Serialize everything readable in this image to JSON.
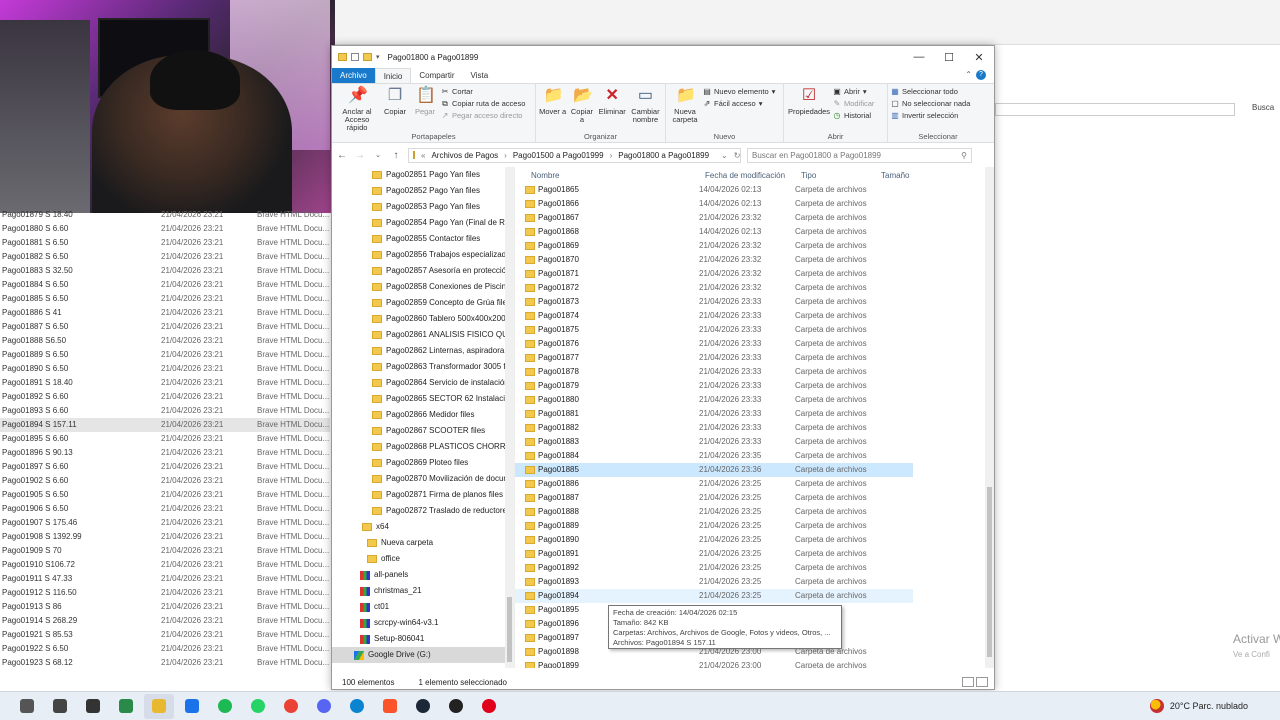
{
  "explorer": {
    "title": "Pago01800 a Pago01899",
    "tabs": {
      "archivo": "Archivo",
      "inicio": "Inicio",
      "compartir": "Compartir",
      "vista": "Vista"
    },
    "ribbon": {
      "portapapeles": {
        "label": "Portapapeles",
        "anclar": "Anclar al Acceso rápido",
        "copiar": "Copiar",
        "pegar": "Pegar",
        "cortar": "Cortar",
        "copiar_ruta": "Copiar ruta de acceso",
        "pegar_acceso": "Pegar acceso directo"
      },
      "organizar": {
        "label": "Organizar",
        "mover": "Mover a",
        "copiar_a": "Copiar a",
        "eliminar": "Eliminar",
        "cambiar": "Cambiar nombre"
      },
      "nuevo": {
        "label": "Nuevo",
        "carpeta": "Nueva carpeta",
        "nuevo_elemento": "Nuevo elemento",
        "facil": "Fácil acceso"
      },
      "abrir": {
        "label": "Abrir",
        "propiedades": "Propiedades",
        "abrir": "Abrir",
        "modificar": "Modificar",
        "historial": "Historial"
      },
      "seleccionar": {
        "label": "Seleccionar",
        "todo": "Seleccionar todo",
        "nada": "No seleccionar nada",
        "invertir": "Invertir selección"
      }
    },
    "address": {
      "crumbs": [
        "Archivos de Pagos",
        "Pago01500 a Pago01999",
        "Pago01800 a Pago01899"
      ],
      "search_placeholder": "Buscar en Pago01800 a Pago01899"
    },
    "tree": [
      {
        "label": "Pago02851 Pago Yan files",
        "icon": "folder"
      },
      {
        "label": "Pago02852 Pago Yan files",
        "icon": "folder"
      },
      {
        "label": "Pago02853 Pago Yan files",
        "icon": "folder"
      },
      {
        "label": "Pago02854 Pago Yan (Final de ROI",
        "icon": "folder"
      },
      {
        "label": "Pago02855 Contactor files",
        "icon": "folder"
      },
      {
        "label": "Pago02856 Trabajos especializados",
        "icon": "folder"
      },
      {
        "label": "Pago02857 Asesoría en protección",
        "icon": "folder"
      },
      {
        "label": "Pago02858 Conexiones de Piscina",
        "icon": "folder"
      },
      {
        "label": "Pago02859 Concepto de Grúa files",
        "icon": "folder"
      },
      {
        "label": "Pago02860 Tablero 500x400x200 , I",
        "icon": "folder"
      },
      {
        "label": "Pago02861 ANALISIS FISICO QUIM",
        "icon": "folder"
      },
      {
        "label": "Pago02862 Linternas, aspiradora, h",
        "icon": "folder"
      },
      {
        "label": "Pago02863 Transformador 3005 fil",
        "icon": "folder"
      },
      {
        "label": "Pago02864 Servicio de instalación",
        "icon": "folder"
      },
      {
        "label": "Pago02865 SECTOR 62 Instalación",
        "icon": "folder"
      },
      {
        "label": "Pago02866 Medidor files",
        "icon": "folder"
      },
      {
        "label": "Pago02867 SCOOTER files",
        "icon": "folder"
      },
      {
        "label": "Pago02868 PLASTICOS CHORRILLO",
        "icon": "folder"
      },
      {
        "label": "Pago02869 Ploteo files",
        "icon": "folder"
      },
      {
        "label": "Pago02870 Movilización de docum",
        "icon": "folder"
      },
      {
        "label": "Pago02871 Firma de planos files",
        "icon": "folder"
      },
      {
        "label": "Pago02872 Traslado de reductores",
        "icon": "folder"
      },
      {
        "label": "x64",
        "icon": "folder"
      },
      {
        "label": "Nueva carpeta",
        "icon": "folder"
      },
      {
        "label": "office",
        "icon": "folder"
      },
      {
        "label": "all-panels",
        "icon": "archive"
      },
      {
        "label": "christmas_21",
        "icon": "archive"
      },
      {
        "label": "ct01",
        "icon": "archive"
      },
      {
        "label": "scrcpy-win64-v3.1",
        "icon": "archive"
      },
      {
        "label": "Setup-806041",
        "icon": "archive"
      },
      {
        "label": "Google Drive (G:)",
        "icon": "drive"
      }
    ],
    "columns": {
      "name": "Nombre",
      "date": "Fecha de modificación",
      "type": "Tipo",
      "size": "Tamaño"
    },
    "files": [
      {
        "name": "Pago01865",
        "date": "14/04/2026 02:13",
        "type": "Carpeta de archivos"
      },
      {
        "name": "Pago01866",
        "date": "14/04/2026 02:13",
        "type": "Carpeta de archivos"
      },
      {
        "name": "Pago01867",
        "date": "21/04/2026 23:32",
        "type": "Carpeta de archivos"
      },
      {
        "name": "Pago01868",
        "date": "14/04/2026 02:13",
        "type": "Carpeta de archivos"
      },
      {
        "name": "Pago01869",
        "date": "21/04/2026 23:32",
        "type": "Carpeta de archivos"
      },
      {
        "name": "Pago01870",
        "date": "21/04/2026 23:32",
        "type": "Carpeta de archivos"
      },
      {
        "name": "Pago01871",
        "date": "21/04/2026 23:32",
        "type": "Carpeta de archivos"
      },
      {
        "name": "Pago01872",
        "date": "21/04/2026 23:32",
        "type": "Carpeta de archivos"
      },
      {
        "name": "Pago01873",
        "date": "21/04/2026 23:33",
        "type": "Carpeta de archivos"
      },
      {
        "name": "Pago01874",
        "date": "21/04/2026 23:33",
        "type": "Carpeta de archivos"
      },
      {
        "name": "Pago01875",
        "date": "21/04/2026 23:33",
        "type": "Carpeta de archivos"
      },
      {
        "name": "Pago01876",
        "date": "21/04/2026 23:33",
        "type": "Carpeta de archivos"
      },
      {
        "name": "Pago01877",
        "date": "21/04/2026 23:33",
        "type": "Carpeta de archivos"
      },
      {
        "name": "Pago01878",
        "date": "21/04/2026 23:33",
        "type": "Carpeta de archivos"
      },
      {
        "name": "Pago01879",
        "date": "21/04/2026 23:33",
        "type": "Carpeta de archivos"
      },
      {
        "name": "Pago01880",
        "date": "21/04/2026 23:33",
        "type": "Carpeta de archivos"
      },
      {
        "name": "Pago01881",
        "date": "21/04/2026 23:33",
        "type": "Carpeta de archivos"
      },
      {
        "name": "Pago01882",
        "date": "21/04/2026 23:33",
        "type": "Carpeta de archivos"
      },
      {
        "name": "Pago01883",
        "date": "21/04/2026 23:33",
        "type": "Carpeta de archivos"
      },
      {
        "name": "Pago01884",
        "date": "21/04/2026 23:35",
        "type": "Carpeta de archivos"
      },
      {
        "name": "Pago01885",
        "date": "21/04/2026 23:36",
        "type": "Carpeta de archivos",
        "state": "selected"
      },
      {
        "name": "Pago01886",
        "date": "21/04/2026 23:25",
        "type": "Carpeta de archivos"
      },
      {
        "name": "Pago01887",
        "date": "21/04/2026 23:25",
        "type": "Carpeta de archivos"
      },
      {
        "name": "Pago01888",
        "date": "21/04/2026 23:25",
        "type": "Carpeta de archivos"
      },
      {
        "name": "Pago01889",
        "date": "21/04/2026 23:25",
        "type": "Carpeta de archivos"
      },
      {
        "name": "Pago01890",
        "date": "21/04/2026 23:25",
        "type": "Carpeta de archivos"
      },
      {
        "name": "Pago01891",
        "date": "21/04/2026 23:25",
        "type": "Carpeta de archivos"
      },
      {
        "name": "Pago01892",
        "date": "21/04/2026 23:25",
        "type": "Carpeta de archivos"
      },
      {
        "name": "Pago01893",
        "date": "21/04/2026 23:25",
        "type": "Carpeta de archivos"
      },
      {
        "name": "Pago01894",
        "date": "21/04/2026 23:25",
        "type": "Carpeta de archivos",
        "state": "hover"
      },
      {
        "name": "Pago01895",
        "date": "",
        "type": "archivos"
      },
      {
        "name": "Pago01896",
        "date": "",
        "type": "archivos"
      },
      {
        "name": "Pago01897",
        "date": "",
        "type": "archivos"
      },
      {
        "name": "Pago01898",
        "date": "21/04/2026 23:00",
        "type": "Carpeta de archivos"
      },
      {
        "name": "Pago01899",
        "date": "21/04/2026 23:00",
        "type": "Carpeta de archivos"
      }
    ],
    "tooltip": [
      "Fecha de creación: 14/04/2026 02:15",
      "Tamaño: 842 KB",
      "Carpetas: Archivos, Archivos de Google, Fotos y videos, Otros, ...",
      "Archivos: Pago01894 S 157.11"
    ],
    "status": {
      "count": "100 elementos",
      "selected": "1 elemento seleccionado"
    }
  },
  "background": {
    "rows": [
      {
        "name": "Pago01879 S 18.40",
        "date": "21/04/2026 23:21",
        "type": "Brave HTML Docu..."
      },
      {
        "name": "Pago01880 S 6.60",
        "date": "21/04/2026 23:21",
        "type": "Brave HTML Docu..."
      },
      {
        "name": "Pago01881 S 6.50",
        "date": "21/04/2026 23:21",
        "type": "Brave HTML Docu..."
      },
      {
        "name": "Pago01882 S 6.50",
        "date": "21/04/2026 23:21",
        "type": "Brave HTML Docu..."
      },
      {
        "name": "Pago01883 S 32.50",
        "date": "21/04/2026 23:21",
        "type": "Brave HTML Docu..."
      },
      {
        "name": "Pago01884 S 6.50",
        "date": "21/04/2026 23:21",
        "type": "Brave HTML Docu..."
      },
      {
        "name": "Pago01885 S 6.50",
        "date": "21/04/2026 23:21",
        "type": "Brave HTML Docu..."
      },
      {
        "name": "Pago01886 S 41",
        "date": "21/04/2026 23:21",
        "type": "Brave HTML Docu..."
      },
      {
        "name": "Pago01887 S 6.50",
        "date": "21/04/2026 23:21",
        "type": "Brave HTML Docu..."
      },
      {
        "name": "Pago01888 S6.50",
        "date": "21/04/2026 23:21",
        "type": "Brave HTML Docu..."
      },
      {
        "name": "Pago01889 S 6.50",
        "date": "21/04/2026 23:21",
        "type": "Brave HTML Docu..."
      },
      {
        "name": "Pago01890 S 6.50",
        "date": "21/04/2026 23:21",
        "type": "Brave HTML Docu..."
      },
      {
        "name": "Pago01891 S 18.40",
        "date": "21/04/2026 23:21",
        "type": "Brave HTML Docu..."
      },
      {
        "name": "Pago01892 S 6.60",
        "date": "21/04/2026 23:21",
        "type": "Brave HTML Docu..."
      },
      {
        "name": "Pago01893 S 6.60",
        "date": "21/04/2026 23:21",
        "type": "Brave HTML Docu..."
      },
      {
        "name": "Pago01894 S 157.11",
        "date": "21/04/2026 23:21",
        "type": "Brave HTML Docu...",
        "state": "selected"
      },
      {
        "name": "Pago01895 S 6.60",
        "date": "21/04/2026 23:21",
        "type": "Brave HTML Docu..."
      },
      {
        "name": "Pago01896 S 90.13",
        "date": "21/04/2026 23:21",
        "type": "Brave HTML Docu..."
      },
      {
        "name": "Pago01897 S 6.60",
        "date": "21/04/2026 23:21",
        "type": "Brave HTML Docu..."
      },
      {
        "name": "Pago01902 S 6.60",
        "date": "21/04/2026 23:21",
        "type": "Brave HTML Docu..."
      },
      {
        "name": "Pago01905 S 6.50",
        "date": "21/04/2026 23:21",
        "type": "Brave HTML Docu..."
      },
      {
        "name": "Pago01906 S 6.50",
        "date": "21/04/2026 23:21",
        "type": "Brave HTML Docu..."
      },
      {
        "name": "Pago01907 S 175.46",
        "date": "21/04/2026 23:21",
        "type": "Brave HTML Docu..."
      },
      {
        "name": "Pago01908 S 1392.99",
        "date": "21/04/2026 23:21",
        "type": "Brave HTML Docu..."
      },
      {
        "name": "Pago01909 S 70",
        "date": "21/04/2026 23:21",
        "type": "Brave HTML Docu..."
      },
      {
        "name": "Pago01910 S106.72",
        "date": "21/04/2026 23:21",
        "type": "Brave HTML Docu..."
      },
      {
        "name": "Pago01911 S 47.33",
        "date": "21/04/2026 23:21",
        "type": "Brave HTML Docu..."
      },
      {
        "name": "Pago01912 S 116.50",
        "date": "21/04/2026 23:21",
        "type": "Brave HTML Docu..."
      },
      {
        "name": "Pago01913 S 86",
        "date": "21/04/2026 23:21",
        "type": "Brave HTML Docu..."
      },
      {
        "name": "Pago01914 S 268.29",
        "date": "21/04/2026 23:21",
        "type": "Brave HTML Docu..."
      },
      {
        "name": "Pago01921 S 85.53",
        "date": "21/04/2026 23:21",
        "type": "Brave HTML Docu..."
      },
      {
        "name": "Pago01922 S 6.50",
        "date": "21/04/2026 23:21",
        "type": "Brave HTML Docu..."
      },
      {
        "name": "Pago01923 S 68.12",
        "date": "21/04/2026 23:21",
        "type": "Brave HTML Docu..."
      }
    ],
    "search_label": "Busca",
    "activate_title": "Activar W",
    "activate_sub": "Ve a Confi"
  },
  "taskbar": {
    "icons": [
      "search-icon",
      "task-view-icon",
      "store-icon",
      "app-icon",
      "file-explorer-icon",
      "mail-icon",
      "spotify-icon",
      "whatsapp-icon",
      "chrome-icon",
      "discord-icon",
      "edge-icon",
      "brave-icon",
      "steam-icon",
      "github-icon",
      "opera-icon"
    ],
    "weather": "20°C  Parc. nublado"
  }
}
